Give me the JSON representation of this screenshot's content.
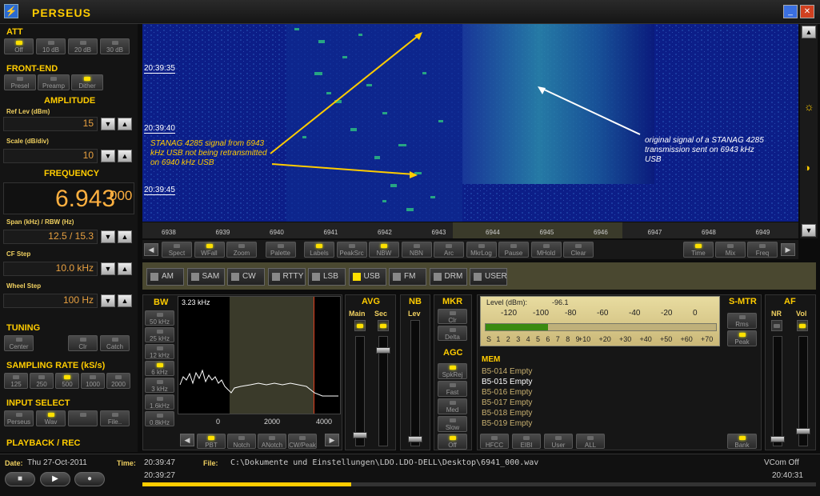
{
  "app": {
    "title": "PERSEUS"
  },
  "att": {
    "title": "ATT",
    "buttons": [
      "Off",
      "10 dB",
      "20 dB",
      "30 dB"
    ],
    "active": 0
  },
  "frontend": {
    "title": "FRONT-END",
    "buttons": [
      "Presel",
      "Preamp",
      "Dither"
    ],
    "active": [
      2
    ]
  },
  "amplitude": {
    "title": "AMPLITUDE",
    "ref_label": "Ref Lev (dBm)",
    "ref_value": "15",
    "scale_label": "Scale (dB/div)",
    "scale_value": "10"
  },
  "frequency": {
    "title": "FREQUENCY",
    "main": "6.943",
    "sub": "000",
    "span_label": "Span (kHz) / RBW (Hz)",
    "span_value": "12.5 / 15.3",
    "cf_label": "CF Step",
    "cf_value": "10.0 kHz",
    "wheel_label": "Wheel Step",
    "wheel_value": "100 Hz"
  },
  "tuning": {
    "title": "TUNING",
    "buttons": [
      "Center",
      "Clr",
      "Catch"
    ]
  },
  "sampling": {
    "title": "SAMPLING RATE (kS/s)",
    "buttons": [
      "125",
      "250",
      "500",
      "1000",
      "2000"
    ],
    "active": 2
  },
  "input": {
    "title": "INPUT SELECT",
    "buttons": [
      "Perseus",
      "Wav",
      "",
      "File.."
    ],
    "active": 1
  },
  "playback": {
    "title": "PLAYBACK / REC"
  },
  "waterfall": {
    "times": [
      "20:39:35",
      "20:39:40",
      "20:39:45"
    ],
    "annotation_left": "STANAG 4285 signal from 6943 kHz USB not being retransmitted on 6940 kHz USB",
    "annotation_right": "original signal of a STANAG 4285 transmission sent on 6943 kHz USB"
  },
  "freq_axis": [
    "6938",
    "6939",
    "6940",
    "6941",
    "6942",
    "6943",
    "6944",
    "6945",
    "6946",
    "6947",
    "6948",
    "6949"
  ],
  "toolbar": {
    "left": [
      "Spect",
      "WFall",
      "Zoom",
      "Palette",
      "Labels",
      "PeakSrc",
      "NBW",
      "NBN",
      "Arc",
      "MkrLog",
      "Pause",
      "MHold",
      "Clear"
    ],
    "left_active": [
      1,
      4,
      6
    ],
    "right": [
      "Time",
      "Mix",
      "Freq"
    ],
    "right_active": [
      0
    ]
  },
  "modes": [
    "AM",
    "SAM",
    "CW",
    "RTTY",
    "LSB",
    "USB",
    "FM",
    "DRM",
    "USER"
  ],
  "mode_active": 5,
  "bw": {
    "title": "BW",
    "value": "3.23 kHz",
    "buttons": [
      "50 kHz",
      "25 kHz",
      "12 kHz",
      "6 kHz",
      "3 kHz",
      "1.6kHz",
      "0.8kHz"
    ],
    "active": 3,
    "axis": [
      "0",
      "2000",
      "4000"
    ],
    "filters": [
      "PBT",
      "Notch",
      "ANotch",
      "CW/Peak"
    ],
    "filters_active": [
      0
    ]
  },
  "avg": {
    "title": "AVG",
    "main": "Main",
    "sec": "Sec"
  },
  "nb": {
    "title": "NB",
    "lev": "Lev"
  },
  "mkr": {
    "title": "MKR",
    "buttons": [
      "Clr",
      "Delta"
    ]
  },
  "agc": {
    "title": "AGC",
    "buttons": [
      "SpkRej",
      "Fast",
      "Med",
      "Slow",
      "Off"
    ],
    "active": [
      0,
      4
    ]
  },
  "smeter": {
    "level_label": "Level (dBm):",
    "level_value": "-96.1",
    "db_scale": [
      "-120",
      "-100",
      "-80",
      "-60",
      "-40",
      "-20",
      "0"
    ],
    "s_scale": [
      "S",
      "1",
      "2",
      "3",
      "4",
      "5",
      "6",
      "7",
      "8",
      "9",
      "+10",
      "+20",
      "+30",
      "+40",
      "+50",
      "+60",
      "+70"
    ],
    "title": "S-MTR",
    "buttons": [
      "Rms",
      "Peak"
    ],
    "level_fraction": 0.27
  },
  "af": {
    "title": "AF",
    "nr": "NR",
    "vol": "Vol"
  },
  "mem": {
    "title": "MEM",
    "rows": [
      "B5-014 Empty",
      "B5-015 Empty",
      "B5-016 Empty",
      "B5-017 Empty",
      "B5-018 Empty",
      "B5-019 Empty"
    ],
    "selected": 1,
    "buttons": [
      "HFCC",
      "EIBI",
      "User",
      "ALL"
    ],
    "bank": "Bank"
  },
  "status": {
    "date_label": "Date:",
    "date": "Thu 27-Oct-2011",
    "time_label": "Time:",
    "time": "20:39:47",
    "file_label": "File:",
    "file": "C:\\Dokumente und Einstellungen\\LDO.LDO-DELL\\Desktop\\6941_000.wav",
    "vcom": "VCom Off",
    "start": "20:39:27",
    "end": "20:40:31",
    "progress": 0.31
  }
}
